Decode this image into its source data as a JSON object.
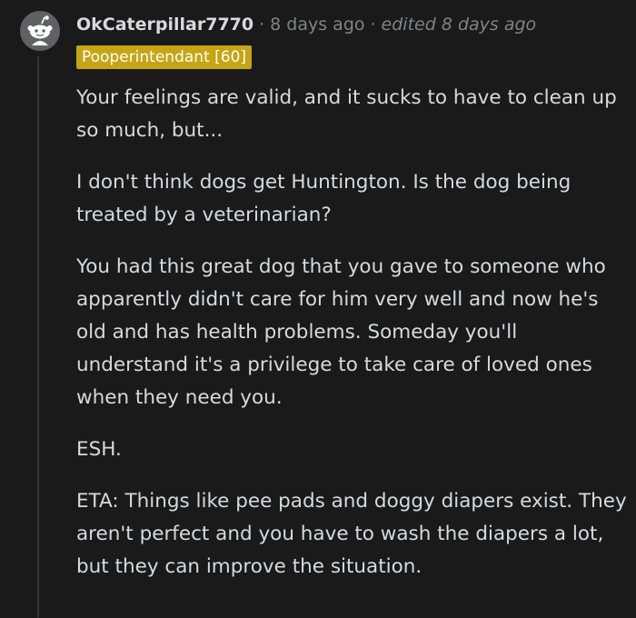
{
  "comment": {
    "author": "OkCaterpillar7770",
    "separator": "·",
    "time_ago": "8 days ago",
    "edited": "edited 8 days ago",
    "flair": "Pooperintendant [60]",
    "paragraphs": [
      "Your feelings are valid, and it sucks to have to clean up so much, but...",
      "I don't think dogs get Huntington. Is the dog being treated by a veterinarian?",
      "You had this great dog that you gave to someone who apparently didn't care for him very well and now he's old and has health problems. Someday you'll understand it's a privilege to take care of loved ones when they need you.",
      "ESH.",
      "ETA: Things like pee pads and doggy diapers exist. They aren't perfect and you have to wash the diapers a lot, but they can improve the situation."
    ]
  },
  "colors": {
    "background": "#1a1a1b",
    "text": "#d7dadc",
    "muted": "#818384",
    "flair_bg": "#c5a514",
    "thread_line": "#343536"
  },
  "icons": {
    "avatar": "reddit-snoo-avatar-icon"
  }
}
